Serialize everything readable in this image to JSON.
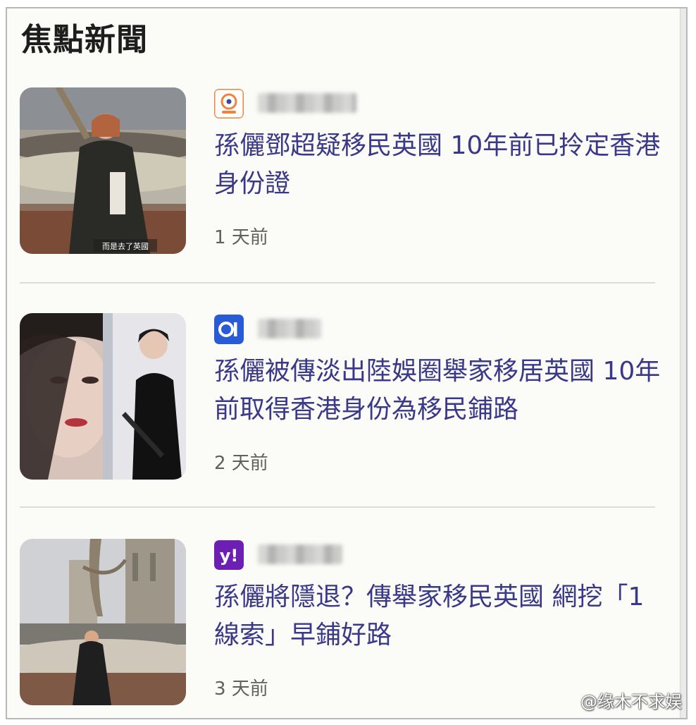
{
  "section_title": "焦點新聞",
  "articles": [
    {
      "headline": "孫儷鄧超疑移民英國 10年前已拎定香港身份證",
      "time": "1 天前",
      "thumb_caption": "而是去了英國",
      "source_icon": "circular-orange-news-logo-icon",
      "source_icon_color": "#f0823c"
    },
    {
      "headline": "孫儷被傳淡出陸娛圈舉家移居英國 10年前取得香港身份為移民鋪路",
      "time": "2 天前",
      "source_icon": "blue-o1-news-logo-icon",
      "source_icon_color": "#2a5bd7"
    },
    {
      "headline": "孫儷將隱退？傳舉家移民英國 網挖「1線索」早鋪好路",
      "time": "3 天前",
      "source_icon": "yahoo-logo-icon",
      "source_icon_text": "y!",
      "source_icon_color": "#6d1fb3"
    }
  ],
  "watermark": "@缘木不求娱",
  "colors": {
    "headline": "#3a3888",
    "time": "#5f5f5f",
    "background": "#fbfbf8"
  }
}
